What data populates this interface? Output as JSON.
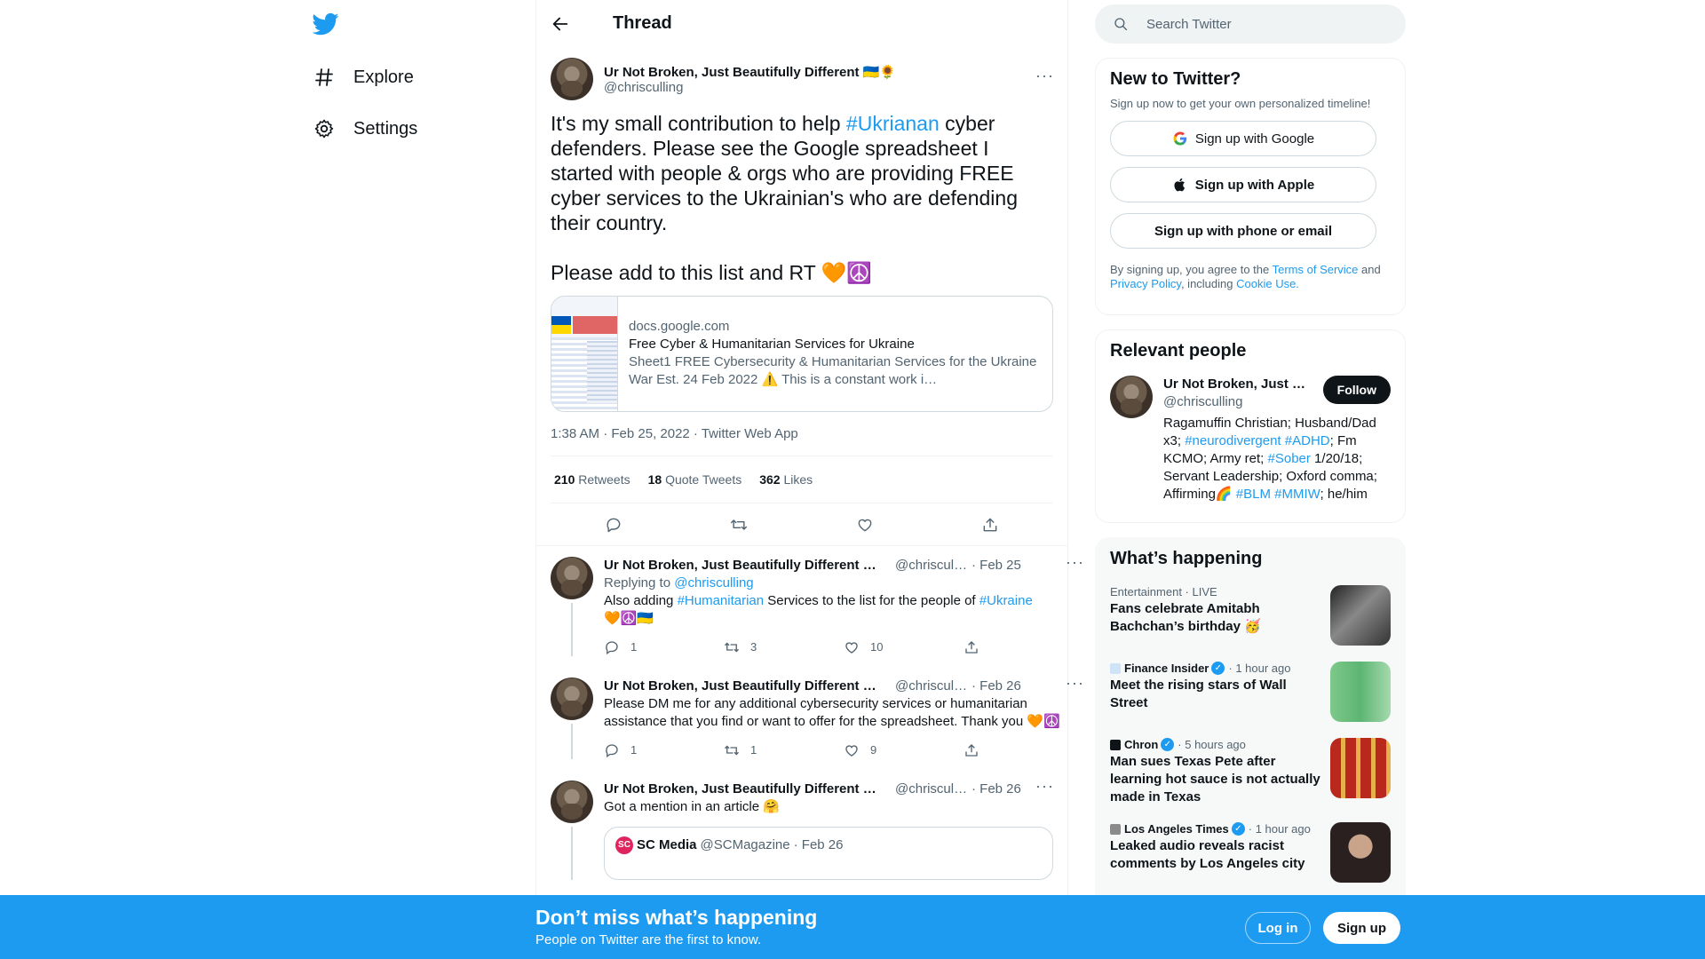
{
  "nav": {
    "logo_icon": "twitter-bird-icon",
    "items": [
      {
        "label": "Explore",
        "icon": "hashtag-icon"
      },
      {
        "label": "Settings",
        "icon": "gear-icon"
      }
    ]
  },
  "header": {
    "title": "Thread"
  },
  "main_tweet": {
    "author_name": "Ur Not Broken, Just Beautifully Different 🇺🇦🌻",
    "author_handle": "@chrisculling",
    "text_before": "It's my small contribution to help ",
    "hashtag": "#Ukrianan",
    "text_after": " cyber defenders. Please see the Google spreadsheet I started with people & orgs who are providing FREE cyber services to the Ukrainian's who are defending their country.\n\nPlease add to this list and RT 🧡☮️",
    "card": {
      "domain": "docs.google.com",
      "title": "Free Cyber & Humanitarian Services for Ukraine",
      "description": "Sheet1 FREE Cybersecurity & Humanitarian Services for the Ukraine War Est. 24 Feb 2022 ⚠️ This is a constant work i…"
    },
    "timestamp": "1:38 AM · Feb 25, 2022 · Twitter Web App",
    "stats": [
      {
        "count": "210",
        "label": "Retweets"
      },
      {
        "count": "18",
        "label": "Quote Tweets"
      },
      {
        "count": "362",
        "label": "Likes"
      }
    ]
  },
  "replies": [
    {
      "name": "Ur Not Broken, Just Beautifully Different 🇺🇦🌻",
      "handle": "@chrisculling",
      "date": "· Feb 25",
      "replying_prefix": "Replying to ",
      "replying_to": "@chrisculling",
      "t1": "Also adding ",
      "h1": "#Humanitarian",
      "t2": " Services to the list for the people of ",
      "h2": "#Ukraine",
      "t3": "🧡☮️🇺🇦",
      "reply_count": "1",
      "retweet_count": "3",
      "like_count": "10"
    },
    {
      "name": "Ur Not Broken, Just Beautifully Different 🇺🇦🌻",
      "handle": "@chrisculling",
      "date": "· Feb 26",
      "text": "Please DM me for any additional cybersecurity services or humanitarian assistance that you find or want to offer for the spreadsheet. Thank you 🧡☮️",
      "reply_count": "1",
      "retweet_count": "1",
      "like_count": "9"
    },
    {
      "name": "Ur Not Broken, Just Beautifully Different 🇺🇦🌻",
      "handle": "@chrisculling",
      "date": "· Feb 26",
      "text": "Got a mention in an article 🤗",
      "quote": {
        "logo": "SC",
        "name": "SC Media",
        "handle": "@SCMagazine",
        "date": "· Feb 26"
      }
    }
  ],
  "search": {
    "placeholder": "Search Twitter"
  },
  "signup": {
    "title": "New to Twitter?",
    "subtitle": "Sign up now to get your own personalized timeline!",
    "google": "Sign up with Google",
    "apple": "Sign up with Apple",
    "phone": "Sign up with phone or email",
    "legal_1": "By signing up, you agree to the ",
    "tos": "Terms of Service",
    "legal_2": " and ",
    "privacy": "Privacy Policy",
    "legal_3": ", including ",
    "cookie": "Cookie Use."
  },
  "relevant": {
    "title": "Relevant people",
    "name": "Ur Not Broken, Just Beautifully Different 🇺🇦🌻",
    "handle": "@chrisculling",
    "follow": "Follow",
    "b1": "Ragamuffin Christian; Husband/Dad x3; ",
    "bh1": "#neurodivergent",
    "b2": " ",
    "bh2": "#ADHD",
    "b3": "; Fm KCMO; Army ret; ",
    "bh3": "#Sober",
    "b4": " 1/20/18; Servant Leadership; Oxford comma; Affirming🌈 ",
    "bh4": "#BLM",
    "b5": " ",
    "bh5": "#MMIW",
    "b6": "; he/him"
  },
  "happening": {
    "title": "What’s happening",
    "trends": [
      {
        "meta": "Entertainment · LIVE",
        "title": "Fans celebrate Amitabh Bachchan’s birthday 🥳"
      },
      {
        "source": "Finance Insider",
        "time": "· 1 hour ago",
        "title": "Meet the rising stars of Wall Street"
      },
      {
        "source": "Chron",
        "time": "· 5 hours ago",
        "title": "Man sues Texas Pete after learning hot sauce is not actually made in Texas"
      },
      {
        "source": "Los Angeles Times",
        "time": "· 1 hour ago",
        "title": "Leaked audio reveals racist comments by Los Angeles city"
      }
    ]
  },
  "bottom": {
    "title": "Don’t miss what’s happening",
    "subtitle": "People on Twitter are the first to know.",
    "login": "Log in",
    "signup": "Sign up"
  },
  "colors": {
    "accent": "#1d9bf0",
    "text": "#0f1419",
    "muted": "#536471"
  }
}
